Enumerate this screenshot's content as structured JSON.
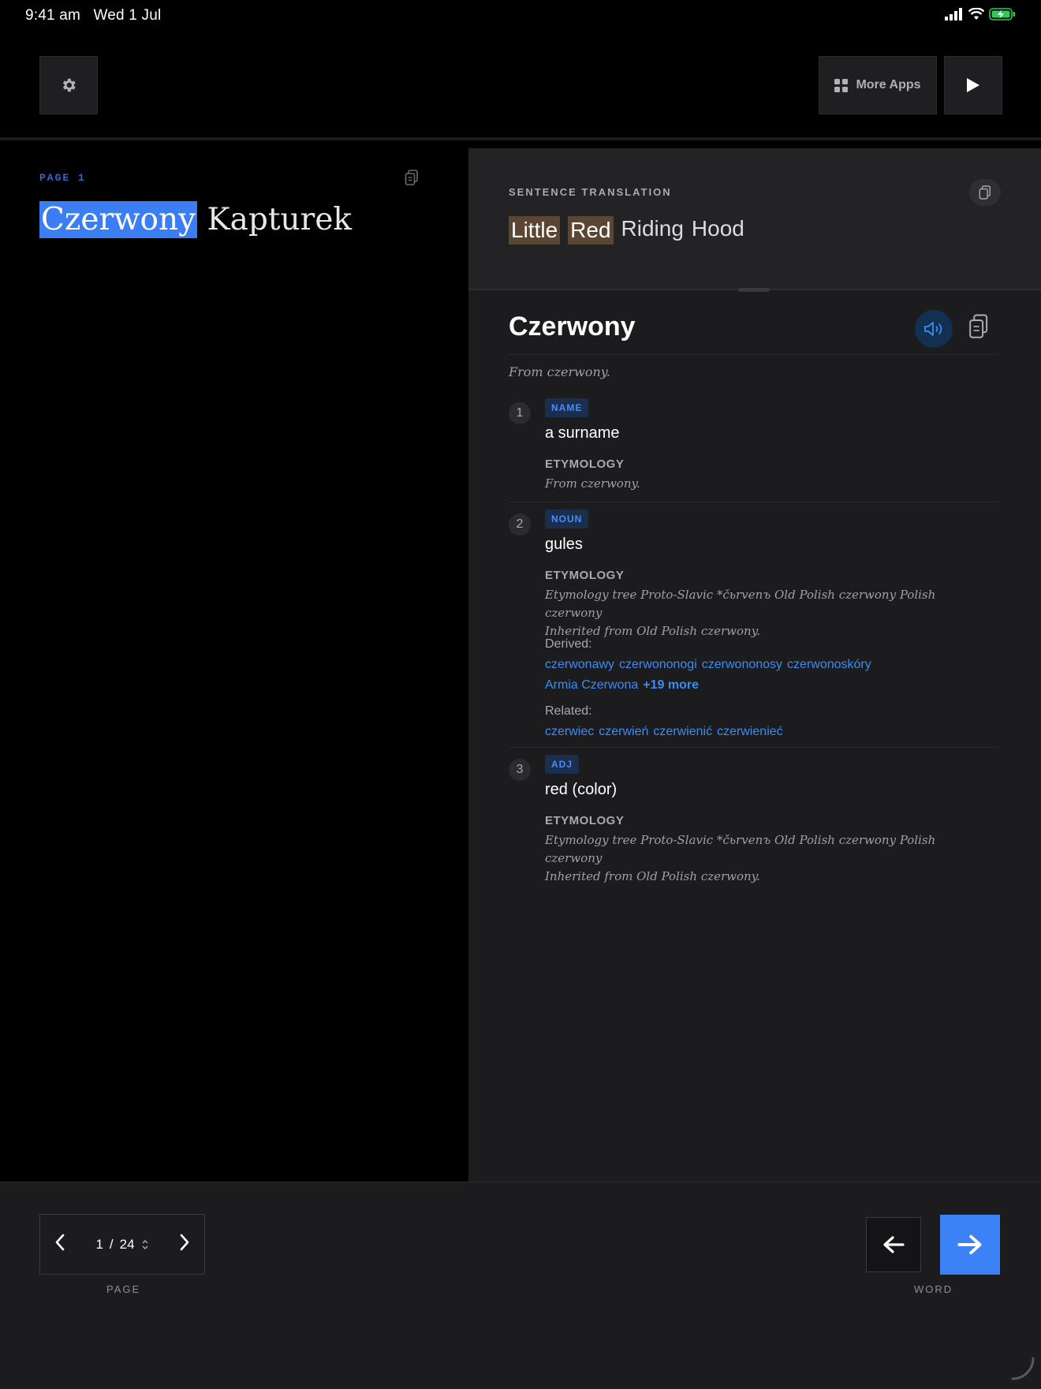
{
  "status": {
    "time": "9:41 am",
    "date": "Wed 1 Jul"
  },
  "toolbar": {
    "more_apps_label": "More Apps"
  },
  "reader": {
    "page_label": "PAGE 1",
    "words": [
      "Czerwony",
      "Kapturek"
    ]
  },
  "translation": {
    "label": "SENTENCE TRANSLATION",
    "words": [
      "Little",
      "Red",
      "Riding",
      "Hood"
    ]
  },
  "entry": {
    "headword": "Czerwony",
    "origin": "From czerwony.",
    "senses": [
      {
        "num": "1",
        "pos": "NAME",
        "gloss": "a surname",
        "ety_label": "ETYMOLOGY",
        "ety_lines": [
          "From czerwony."
        ]
      },
      {
        "num": "2",
        "pos": "NOUN",
        "gloss": "gules",
        "ety_label": "ETYMOLOGY",
        "ety_lines": [
          "Etymology tree Proto-Slavic *čьrvenъ Old Polish czerwony Polish czerwony",
          "Inherited from Old Polish czerwony."
        ],
        "derived_label": "Derived:",
        "derived": [
          "czerwonawy",
          "czerwononogi",
          "czerwononosy",
          "czerwonoskóry",
          "Armia Czerwona"
        ],
        "derived_more": "+19 more",
        "related_label": "Related:",
        "related": [
          "czerwiec",
          "czerwień",
          "czerwienić",
          "czerwienieć"
        ]
      },
      {
        "num": "3",
        "pos": "ADJ",
        "gloss": "red (color)",
        "ety_label": "ETYMOLOGY",
        "ety_lines": [
          "Etymology tree Proto-Slavic *čьrvenъ Old Polish czerwony Polish czerwony",
          "Inherited from Old Polish czerwony."
        ]
      }
    ]
  },
  "pager": {
    "current": "1",
    "separator": "/",
    "total": "24",
    "label": "PAGE"
  },
  "word_nav": {
    "label": "WORD"
  },
  "colors": {
    "accent": "#3b82f6",
    "highlight": "#3b7ef4",
    "translation_highlight": "#5a4632",
    "battery": "#34c759"
  }
}
